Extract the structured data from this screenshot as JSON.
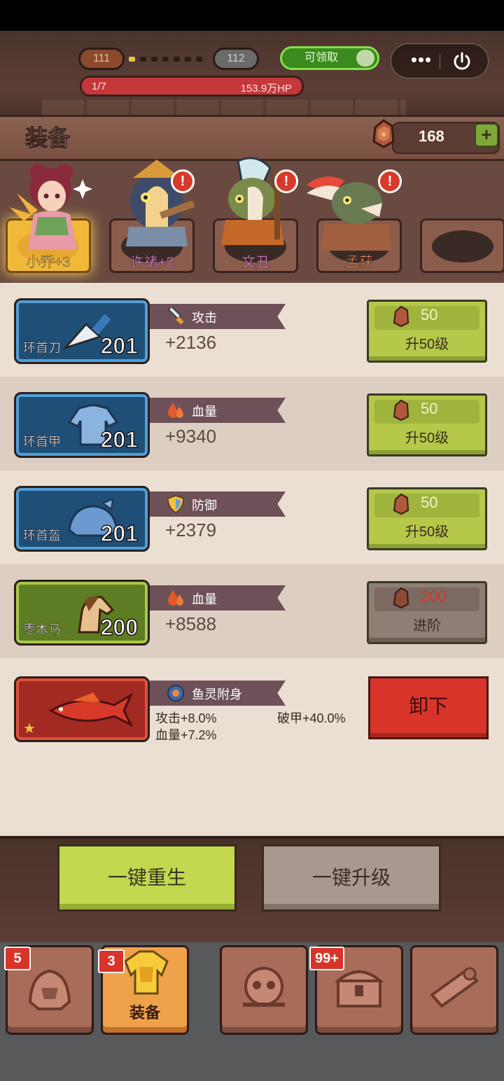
{
  "header": {
    "level_current": "111",
    "level_next": "112",
    "stage_progress": "1/7",
    "boss_hp": "153.9万HP",
    "claim_label": "可领取",
    "more_label": "•••"
  },
  "title": "装备",
  "currency": {
    "count": "168",
    "plus": "+"
  },
  "heroes": [
    {
      "name": "小乔+3",
      "selected": true,
      "alert": false,
      "name_color": "#f6d77a"
    },
    {
      "name": "许褚+2",
      "selected": false,
      "alert": true,
      "name_color": "#f18ef0"
    },
    {
      "name": "文丑",
      "selected": false,
      "alert": true,
      "name_color": "#f18ef0"
    },
    {
      "name": "孟获",
      "selected": false,
      "alert": true,
      "name_color": "#ff9a6a"
    },
    {
      "name": "",
      "selected": false,
      "alert": false,
      "name_color": "#ffffff"
    }
  ],
  "alert_mark": "!",
  "equipment": [
    {
      "name": "环首刀",
      "level": "201",
      "stat": "攻击",
      "stat_icon": "sword-icon",
      "value": "+2136",
      "cost": "50",
      "action": "升50级",
      "rarity": "blue",
      "enabled": true
    },
    {
      "name": "环首甲",
      "level": "201",
      "stat": "血量",
      "stat_icon": "blood-drop-icon",
      "value": "+9340",
      "cost": "50",
      "action": "升50级",
      "rarity": "blue",
      "enabled": true
    },
    {
      "name": "环首盔",
      "level": "201",
      "stat": "防御",
      "stat_icon": "shield-icon",
      "value": "+2379",
      "cost": "50",
      "action": "升50级",
      "rarity": "blue",
      "enabled": true
    },
    {
      "name": "枣木马",
      "level": "200",
      "stat": "血量",
      "stat_icon": "blood-drop-icon",
      "value": "+8588",
      "cost": "200",
      "action": "进阶",
      "rarity": "green",
      "enabled": false
    }
  ],
  "spirit": {
    "title": "鱼灵附身",
    "effects": [
      "攻击+8.0%",
      "血量+7.2%",
      "破甲+40.0%"
    ],
    "star": "★",
    "remove_label": "卸下"
  },
  "actions": {
    "rebirth_label": "一键重生",
    "upgrade_all_label": "一键升级"
  },
  "nav": [
    {
      "name": "heroes",
      "label": "",
      "badge": "5",
      "active": false
    },
    {
      "name": "equipment",
      "label": "装备",
      "badge": "3",
      "active": true
    },
    {
      "name": "boss",
      "label": "",
      "badge": "",
      "active": false
    },
    {
      "name": "chest",
      "label": "",
      "badge": "99+",
      "active": false
    },
    {
      "name": "map",
      "label": "",
      "badge": "",
      "active": false
    }
  ]
}
